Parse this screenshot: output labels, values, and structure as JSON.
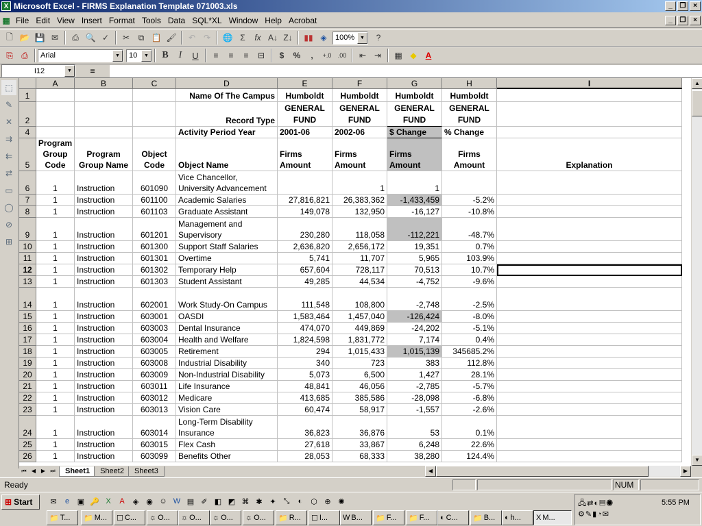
{
  "window": {
    "title": "Microsoft Excel - FIRMS Explanation Template 071003.xls"
  },
  "menu": [
    "File",
    "Edit",
    "View",
    "Insert",
    "Format",
    "Tools",
    "Data",
    "SQL*XL",
    "Window",
    "Help",
    "Acrobat"
  ],
  "toolbar": {
    "zoom": "100%",
    "font": "Arial",
    "size": "10"
  },
  "formula_bar": {
    "name_box": "I12",
    "equals": "=",
    "content": ""
  },
  "columns": [
    "A",
    "B",
    "C",
    "D",
    "E",
    "F",
    "G",
    "H",
    "I"
  ],
  "header_rows": {
    "r1": {
      "num": "1",
      "D": "Name Of The Campus",
      "E": "Humboldt",
      "F": "Humboldt",
      "G": "Humboldt",
      "H": "Humboldt"
    },
    "r2": {
      "num": "2",
      "D": "Record Type",
      "E": "GENERAL FUND",
      "F": "GENERAL FUND",
      "G": "GENERAL FUND",
      "H": "GENERAL FUND"
    },
    "r4": {
      "num": "4",
      "D": "Activity Period Year",
      "E": "2001-06",
      "F": "2002-06",
      "G": "$ Change",
      "H": "% Change"
    },
    "r5": {
      "num": "5",
      "A": "Program Group Code",
      "B": "Program Group Name",
      "C": "Object Code",
      "D": "Object Name",
      "E": "Firms Amount",
      "F": "Firms Amount",
      "G": "Firms Amount",
      "H": "Firms Amount",
      "I": "Explanation"
    }
  },
  "rows": [
    {
      "num": "6",
      "A": "1",
      "B": "Instruction",
      "C": "601090",
      "D": "Vice Chancellor, University Advancement",
      "E": "",
      "F": "1",
      "G": "1",
      "H": "",
      "shade": false
    },
    {
      "num": "7",
      "A": "1",
      "B": "Instruction",
      "C": "601100",
      "D": "Academic Salaries",
      "E": "27,816,821",
      "F": "26,383,362",
      "G": "-1,433,459",
      "H": "-5.2%",
      "shade": true
    },
    {
      "num": "8",
      "A": "1",
      "B": "Instruction",
      "C": "601103",
      "D": "Graduate Assistant",
      "E": "149,078",
      "F": "132,950",
      "G": "-16,127",
      "H": "-10.8%",
      "shade": false
    },
    {
      "num": "9",
      "A": "1",
      "B": "Instruction",
      "C": "601201",
      "D": "Management and Supervisory",
      "E": "230,280",
      "F": "118,058",
      "G": "-112,221",
      "H": "-48.7%",
      "shade": true
    },
    {
      "num": "10",
      "A": "1",
      "B": "Instruction",
      "C": "601300",
      "D": "Support Staff Salaries",
      "E": "2,636,820",
      "F": "2,656,172",
      "G": "19,351",
      "H": "0.7%",
      "shade": false
    },
    {
      "num": "11",
      "A": "1",
      "B": "Instruction",
      "C": "601301",
      "D": "Overtime",
      "E": "5,741",
      "F": "11,707",
      "G": "5,965",
      "H": "103.9%",
      "shade": false
    },
    {
      "num": "12",
      "A": "1",
      "B": "Instruction",
      "C": "601302",
      "D": "Temporary Help",
      "E": "657,604",
      "F": "728,117",
      "G": "70,513",
      "H": "10.7%",
      "shade": false
    },
    {
      "num": "13",
      "A": "1",
      "B": "Instruction",
      "C": "601303",
      "D": "Student Assistant",
      "E": "49,285",
      "F": "44,534",
      "G": "-4,752",
      "H": "-9.6%",
      "shade": false
    },
    {
      "num": "14",
      "A": "1",
      "B": "Instruction",
      "C": "602001",
      "D": "Work Study-On Campus",
      "E": "111,548",
      "F": "108,800",
      "G": "-2,748",
      "H": "-2.5%",
      "shade": false
    },
    {
      "num": "15",
      "A": "1",
      "B": "Instruction",
      "C": "603001",
      "D": "OASDI",
      "E": "1,583,464",
      "F": "1,457,040",
      "G": "-126,424",
      "H": "-8.0%",
      "shade": true
    },
    {
      "num": "16",
      "A": "1",
      "B": "Instruction",
      "C": "603003",
      "D": "Dental Insurance",
      "E": "474,070",
      "F": "449,869",
      "G": "-24,202",
      "H": "-5.1%",
      "shade": false
    },
    {
      "num": "17",
      "A": "1",
      "B": "Instruction",
      "C": "603004",
      "D": "Health and Welfare",
      "E": "1,824,598",
      "F": "1,831,772",
      "G": "7,174",
      "H": "0.4%",
      "shade": false
    },
    {
      "num": "18",
      "A": "1",
      "B": "Instruction",
      "C": "603005",
      "D": "Retirement",
      "E": "294",
      "F": "1,015,433",
      "G": "1,015,139",
      "H": "345685.2%",
      "shade": true
    },
    {
      "num": "19",
      "A": "1",
      "B": "Instruction",
      "C": "603008",
      "D": "Industrial Disability",
      "E": "340",
      "F": "723",
      "G": "383",
      "H": "112.8%",
      "shade": false
    },
    {
      "num": "20",
      "A": "1",
      "B": "Instruction",
      "C": "603009",
      "D": "Non-Industrial Disability",
      "E": "5,073",
      "F": "6,500",
      "G": "1,427",
      "H": "28.1%",
      "shade": false
    },
    {
      "num": "21",
      "A": "1",
      "B": "Instruction",
      "C": "603011",
      "D": "Life Insurance",
      "E": "48,841",
      "F": "46,056",
      "G": "-2,785",
      "H": "-5.7%",
      "shade": false
    },
    {
      "num": "22",
      "A": "1",
      "B": "Instruction",
      "C": "603012",
      "D": "Medicare",
      "E": "413,685",
      "F": "385,586",
      "G": "-28,098",
      "H": "-6.8%",
      "shade": false
    },
    {
      "num": "23",
      "A": "1",
      "B": "Instruction",
      "C": "603013",
      "D": "Vision Care",
      "E": "60,474",
      "F": "58,917",
      "G": "-1,557",
      "H": "-2.6%",
      "shade": false
    },
    {
      "num": "24",
      "A": "1",
      "B": "Instruction",
      "C": "603014",
      "D": "Long-Term Disability Insurance",
      "E": "36,823",
      "F": "36,876",
      "G": "53",
      "H": "0.1%",
      "shade": false
    },
    {
      "num": "25",
      "A": "1",
      "B": "Instruction",
      "C": "603015",
      "D": "Flex Cash",
      "E": "27,618",
      "F": "33,867",
      "G": "6,248",
      "H": "22.6%",
      "shade": false
    },
    {
      "num": "26",
      "A": "1",
      "B": "Instruction",
      "C": "603099",
      "D": "Benefits Other",
      "E": "28,053",
      "F": "68,333",
      "G": "38,280",
      "H": "124.4%",
      "shade": false
    }
  ],
  "sheets": [
    "Sheet1",
    "Sheet2",
    "Sheet3"
  ],
  "status": {
    "ready": "Ready",
    "num": "NUM"
  },
  "taskbar": {
    "start": "Start",
    "clock": "5:55 PM",
    "tasks": [
      "T...",
      "M...",
      "C...",
      "O...",
      "O...",
      "O...",
      "O...",
      "R...",
      "I...",
      "B...",
      "F...",
      "F...",
      "C...",
      "B...",
      "h...",
      "M..."
    ]
  }
}
